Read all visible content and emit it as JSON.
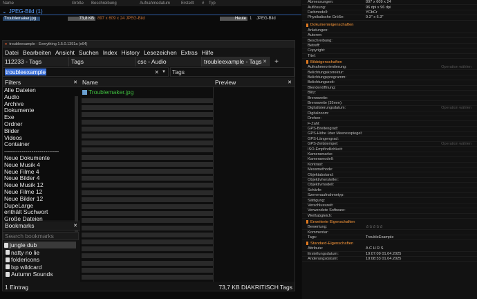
{
  "bg": {
    "headers": [
      "Name",
      "Größe",
      "Beschreibung",
      "Aufnahmedatum",
      "Erstellt",
      "#",
      "Typ"
    ],
    "group": "JPEG-Bild (1)",
    "file": {
      "name": "Troublemaker.jpg",
      "size": "73,8 KB",
      "desc": "897 x 609 x 24 JPEG-Bild",
      "created": "Heute",
      "num": "1",
      "type": "JPEG-Bild"
    }
  },
  "props": {
    "top": [
      {
        "k": "Abmessungen:",
        "v": "897 x 609 x 24"
      },
      {
        "k": "Auflösung:",
        "v": "96 dpi x 96 dpi"
      },
      {
        "k": "Farbmodell:",
        "v": "YCbCr"
      },
      {
        "k": "Physikalische Größe:",
        "v": "9.3\" x 6.3\""
      }
    ],
    "sec_doc": "Dokumenteigenschaften",
    "doc": [
      "Anlatungen:",
      "Autoren:",
      "Beschreibung:",
      "Betreff:",
      "Copyright:",
      "Titel:"
    ],
    "sec_img": "Bildeigenschaften",
    "img": [
      "Aufnahmeorientierung:",
      "Belichtungskorrektur:",
      "Belichtungsprogramm:",
      "Belichtungszeit:",
      "Blendenöffnung:",
      "Blitz:",
      "Brennweite:",
      "Brennweite (35mm):",
      "Digitalisierungsdatum:",
      "Digitalzoom:",
      "Drehen:",
      "F-Zahl:",
      "GPS-Breitengrad:",
      "GPS-Höhe über Meeresspiegel:",
      "GPS-Längengrad:",
      "GPS-Zeitstempel:",
      "ISO-Empfindlichkeit:",
      "Kameramarke:",
      "Kameramodell:",
      "Kontrast:",
      "Messmethode:",
      "Objektabstand:",
      "Objektivhersteller:",
      "Objektivmodell:",
      "Schärfe:",
      "Szenenaufnahmetyp:",
      "Sättigung:",
      "Verschlusszeit:",
      "Verwendete Software:",
      "Weißabgleich:"
    ],
    "hint": "Operation wählen",
    "sec_ext": "Erweiterte Eigenschaften",
    "ext": [
      {
        "k": "Bewertung:",
        "v": "☆☆☆☆☆"
      },
      {
        "k": "Kommentar:",
        "v": ""
      },
      {
        "k": "Tags:",
        "v": "TroubleExample"
      }
    ],
    "sec_std": "Standard-Eigenschaften",
    "std": [
      {
        "k": "Attribute:",
        "v": "A  C  H  R  S"
      },
      {
        "k": "Erstellungsdatum:",
        "v": "19:07:09        01.04.2025"
      },
      {
        "k": "Änderungsdatum:",
        "v": "19:08:33        01.04.2025"
      }
    ]
  },
  "win": {
    "title": "troubleexample - Everything 1.5.0.1391a (x64)",
    "menu": [
      "Datei",
      "Bearbeiten",
      "Ansicht",
      "Suchen",
      "Index",
      "History",
      "Lesezeichen",
      "Extras",
      "Hilfe"
    ],
    "tabs": [
      "112233 - Tags",
      "Tags",
      "csc - Audio",
      "troubleexample - Tags"
    ],
    "add_tab": "+",
    "search_value": "troubleexample",
    "filter_value": "Tags",
    "filters_title": "Filters",
    "filters": [
      "Alle Dateien",
      "Audio",
      "Archive",
      "Dokumente",
      "Exe",
      "Ordner",
      "Bilder",
      "Videos",
      "Container",
      "----------------------------",
      "Neue Dokumente",
      "Neue Musik 4",
      "Neue Filme 4",
      "Neue Bilder 4",
      "Neue Musik 12",
      "Neue Filme 12",
      "Neue Bilder 12",
      "DupeLarge",
      "enthält Suchwort",
      "Große Dateien"
    ],
    "bookmarks_title": "Bookmarks",
    "bookmarks_search": "Search bookmarks",
    "bookmarks": [
      "jungle dub",
      "natty no lie",
      "foldericons",
      "lxp wildcard",
      "Autumn Sounds"
    ],
    "name_header": "Name",
    "preview_header": "Preview",
    "result": "Troublemaker.jpg",
    "status_left": "1 Eintrag",
    "status_right": "73,7 KB  DIAKRITISCH  Tags"
  }
}
